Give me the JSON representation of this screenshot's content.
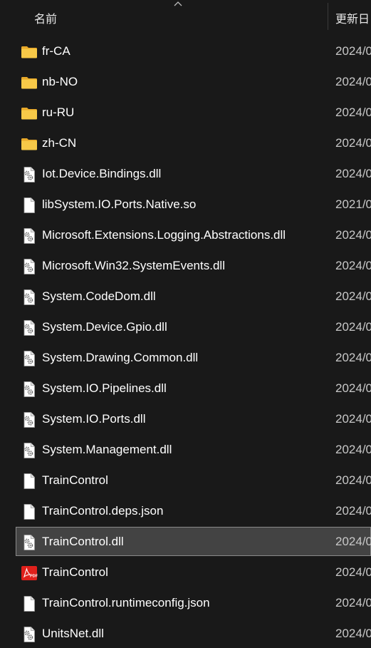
{
  "header": {
    "name_label": "名前",
    "date_label": "更新日"
  },
  "files": [
    {
      "name": "fr-CA",
      "date": "2024/0",
      "icon": "folder-icon"
    },
    {
      "name": "nb-NO",
      "date": "2024/0",
      "icon": "folder-icon"
    },
    {
      "name": "ru-RU",
      "date": "2024/0",
      "icon": "folder-icon"
    },
    {
      "name": "zh-CN",
      "date": "2024/0",
      "icon": "folder-icon"
    },
    {
      "name": "Iot.Device.Bindings.dll",
      "date": "2024/0",
      "icon": "dll-file-icon"
    },
    {
      "name": "libSystem.IO.Ports.Native.so",
      "date": "2021/0",
      "icon": "blank-file-icon"
    },
    {
      "name": "Microsoft.Extensions.Logging.Abstractions.dll",
      "date": "2024/0",
      "icon": "dll-file-icon"
    },
    {
      "name": "Microsoft.Win32.SystemEvents.dll",
      "date": "2024/0",
      "icon": "dll-file-icon"
    },
    {
      "name": "System.CodeDom.dll",
      "date": "2024/0",
      "icon": "dll-file-icon"
    },
    {
      "name": "System.Device.Gpio.dll",
      "date": "2024/0",
      "icon": "dll-file-icon"
    },
    {
      "name": "System.Drawing.Common.dll",
      "date": "2024/0",
      "icon": "dll-file-icon"
    },
    {
      "name": "System.IO.Pipelines.dll",
      "date": "2024/0",
      "icon": "dll-file-icon"
    },
    {
      "name": "System.IO.Ports.dll",
      "date": "2024/0",
      "icon": "dll-file-icon"
    },
    {
      "name": "System.Management.dll",
      "date": "2024/0",
      "icon": "dll-file-icon"
    },
    {
      "name": "TrainControl",
      "date": "2024/0",
      "icon": "blank-file-icon"
    },
    {
      "name": "TrainControl.deps.json",
      "date": "2024/0",
      "icon": "blank-file-icon"
    },
    {
      "name": "TrainControl.dll",
      "date": "2024/0",
      "icon": "dll-file-icon",
      "selected": true
    },
    {
      "name": "TrainControl",
      "date": "2024/0",
      "icon": "pdf-icon"
    },
    {
      "name": "TrainControl.runtimeconfig.json",
      "date": "2024/0",
      "icon": "blank-file-icon"
    },
    {
      "name": "UnitsNet.dll",
      "date": "2024/0",
      "icon": "dll-file-icon"
    }
  ],
  "colors": {
    "background": "#191919",
    "selection": "#434343",
    "folder": "#f7c948",
    "pdf": "#e0201b"
  }
}
